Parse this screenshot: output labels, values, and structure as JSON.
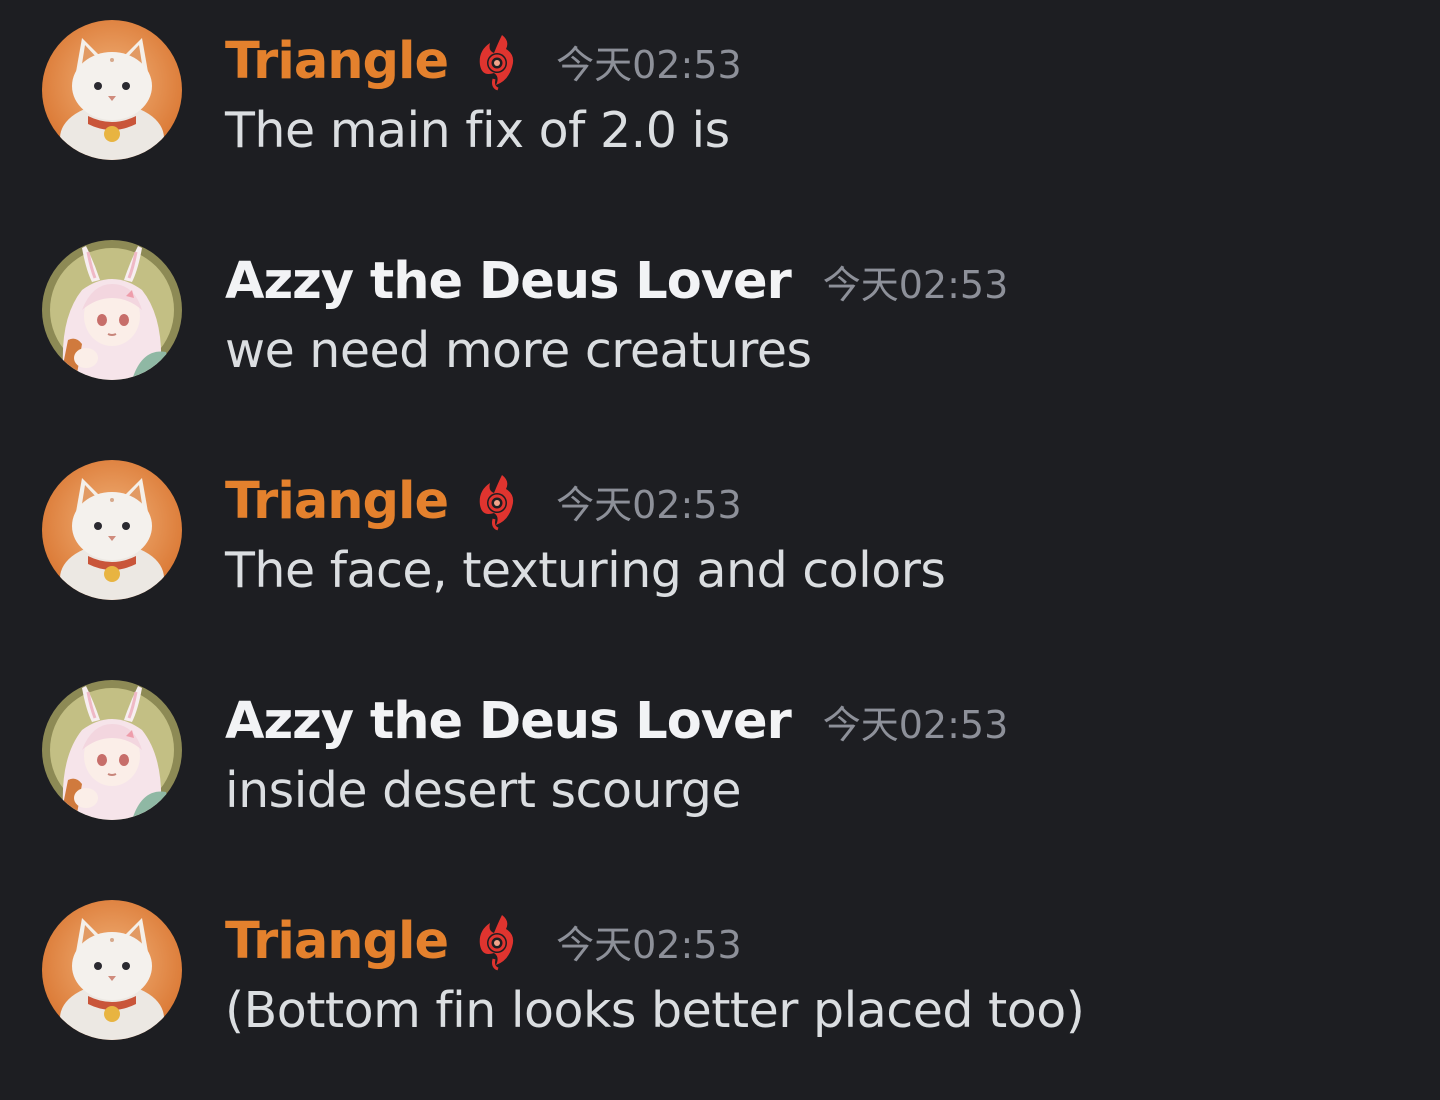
{
  "messages": [
    {
      "author": "Triangle",
      "author_color": "#e4812d",
      "avatar_icon": "cat-avatar",
      "role_icon": "flame-badge-icon",
      "timestamp": "今天02:53",
      "text": "The main fix of 2.0 is"
    },
    {
      "author": "Azzy the Deus Lover",
      "author_color": "#f2f3f5",
      "avatar_icon": "anime-bunny-girl-avatar",
      "timestamp": "今天02:53",
      "text": "we need more creatures"
    },
    {
      "author": "Triangle",
      "author_color": "#e4812d",
      "avatar_icon": "cat-avatar",
      "role_icon": "flame-badge-icon",
      "timestamp": "今天02:53",
      "text": "The face, texturing and colors"
    },
    {
      "author": "Azzy the Deus Lover",
      "author_color": "#f2f3f5",
      "avatar_icon": "anime-bunny-girl-avatar",
      "timestamp": "今天02:53",
      "text": "inside desert scourge"
    },
    {
      "author": "Triangle",
      "author_color": "#e4812d",
      "avatar_icon": "cat-avatar",
      "role_icon": "flame-badge-icon",
      "timestamp": "今天02:53",
      "text": "(Bottom fin looks better placed too)"
    }
  ],
  "colors": {
    "background": "#1d1e22",
    "timestamp": "#8d9099",
    "message_text": "#dbdee1"
  }
}
